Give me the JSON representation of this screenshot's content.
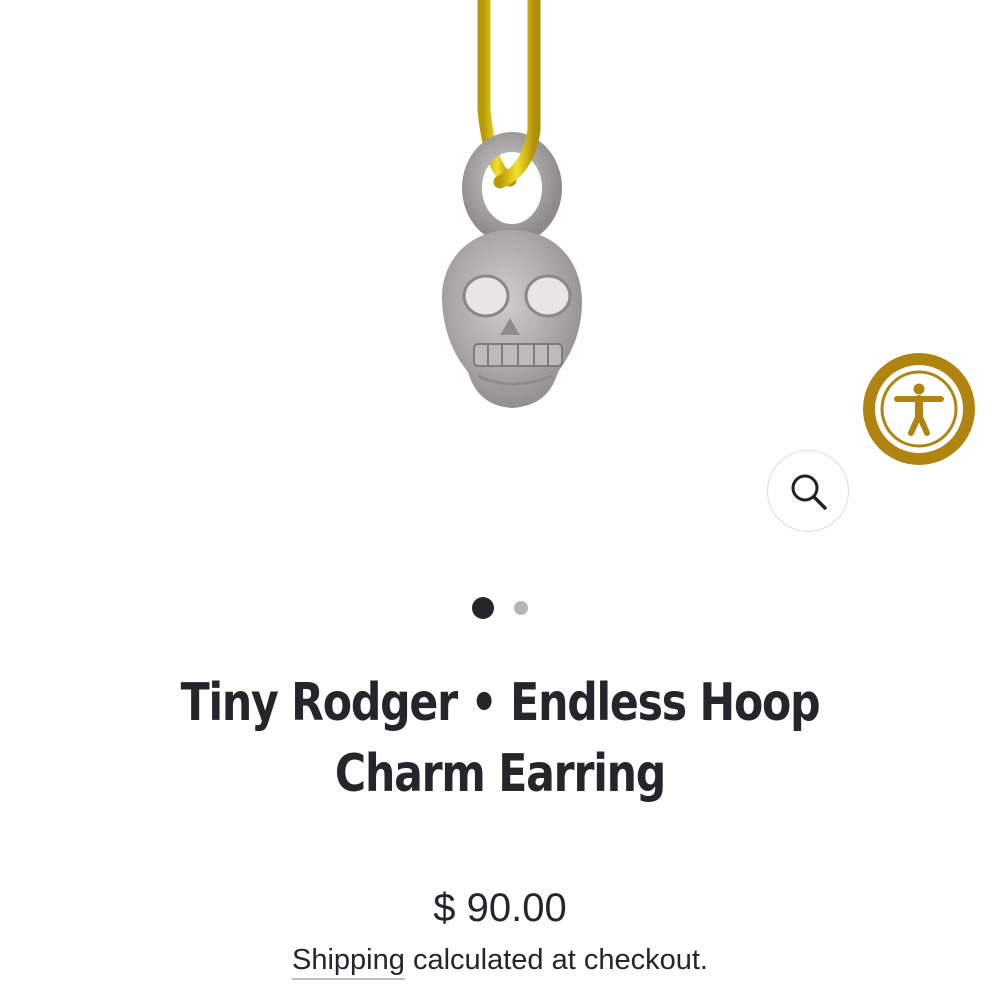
{
  "product": {
    "title": "Tiny Rodger • Endless Hoop Charm Earring",
    "price": "$ 90.00",
    "shipping_link": "Shipping",
    "shipping_rest": " calculated at checkout."
  },
  "gallery": {
    "image_count": 2,
    "active_index": 0
  },
  "icons": {
    "zoom": "magnifier-icon",
    "accessibility": "accessibility-person-icon"
  },
  "colors": {
    "accent_gold": "#b08410",
    "text": "#25252b",
    "dot_inactive": "#b5b5b5"
  }
}
